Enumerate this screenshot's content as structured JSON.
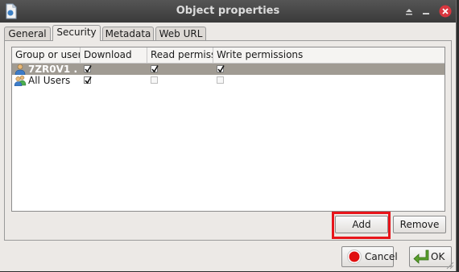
{
  "window": {
    "title": "Object properties",
    "icons": [
      "document-icon",
      "shade-icon",
      "minimize-icon",
      "close-icon"
    ]
  },
  "tabs": [
    {
      "label": "General",
      "active": false
    },
    {
      "label": "Security",
      "active": true
    },
    {
      "label": "Metadata",
      "active": false
    },
    {
      "label": "Web URL",
      "active": false
    }
  ],
  "permissions_table": {
    "columns": [
      "Group or user name",
      "Download",
      "Read permissions",
      "Write permissions"
    ],
    "rows": [
      {
        "name": "7ZR0V1 ...",
        "icon": "user-icon",
        "selected": true,
        "download": true,
        "read": true,
        "write": true
      },
      {
        "name": "All Users",
        "icon": "group-icon",
        "selected": false,
        "download": true,
        "read": false,
        "write": false
      }
    ]
  },
  "buttons": {
    "add": "Add",
    "remove": "Remove",
    "cancel": "Cancel",
    "ok": "OK"
  },
  "colors": {
    "highlight": "#e8151b",
    "selected_row": "#a09b93",
    "titlebar": "#444444"
  }
}
